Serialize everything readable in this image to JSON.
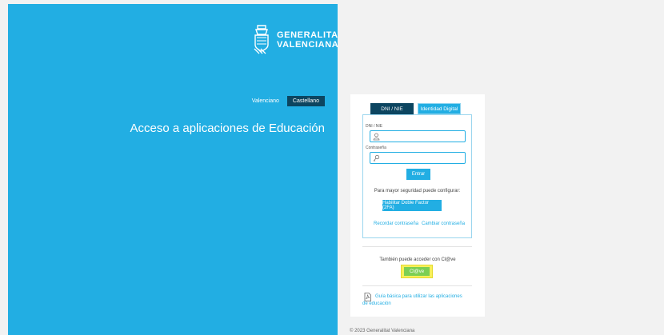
{
  "brand": {
    "logo_line1": "GENERALITAT",
    "logo_line2": "VALENCIANA",
    "primary_color": "#22aee3",
    "dark_color": "#0c4560",
    "clave_color": "#7ccf53"
  },
  "language": {
    "valenciano": "Valenciano",
    "castellano": "Castellano"
  },
  "page_title": "Acceso a aplicaciones de Educación",
  "tabs": {
    "dni": "DNI / NIE",
    "identidad": "Identidad Digital"
  },
  "form": {
    "dni_label": "DNI / NIE",
    "dni_value": "",
    "password_label": "Contraseña",
    "password_value": "",
    "entrar": "Entrar",
    "security_text": "Para mayor seguridad puede configurar:",
    "two_factor": "Habilitar Doble Factor (2FA)",
    "remember_password": "Recordar contraseña",
    "change_password": "Cambiar contraseña"
  },
  "clave": {
    "text": "También puede acceder con Cl@ve",
    "button": "Cl@ve"
  },
  "guide": {
    "link": "Guía básica para utilizar las aplicaciones de educación",
    "icon": "pdf-icon"
  },
  "footer": "© 2023 Generalitat Valenciana"
}
